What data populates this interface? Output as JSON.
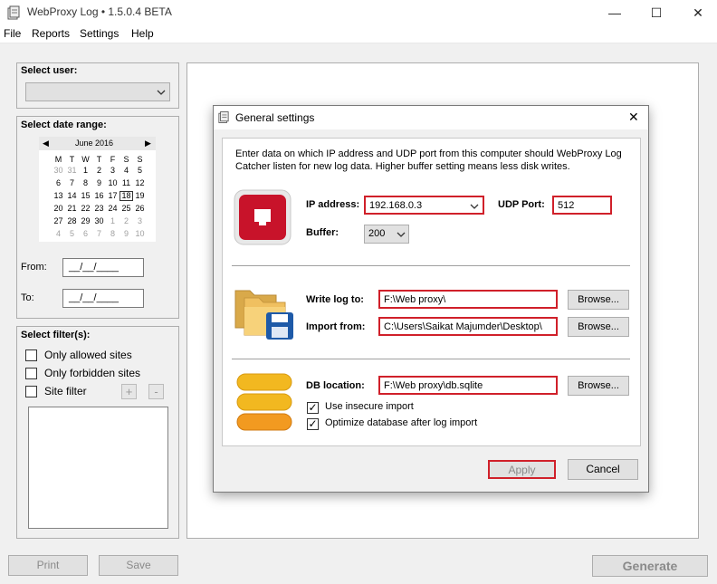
{
  "window": {
    "title": "WebProxy Log • 1.5.0.4 BETA",
    "minimize": "—",
    "maximize": "☐",
    "close": "✕"
  },
  "menu": [
    "File",
    "Reports",
    "Settings",
    "Help"
  ],
  "left": {
    "select_user_label": "Select user:",
    "select_date_label": "Select date range:",
    "calendar": {
      "month": "June 2016",
      "days": [
        "M",
        "T",
        "W",
        "T",
        "F",
        "S",
        "S"
      ],
      "weeks": [
        [
          "30",
          "31",
          "1",
          "2",
          "3",
          "4",
          "5"
        ],
        [
          "6",
          "7",
          "8",
          "9",
          "10",
          "11",
          "12"
        ],
        [
          "13",
          "14",
          "15",
          "16",
          "17",
          "18",
          "19"
        ],
        [
          "20",
          "21",
          "22",
          "23",
          "24",
          "25",
          "26"
        ],
        [
          "27",
          "28",
          "29",
          "30",
          "1",
          "2",
          "3"
        ],
        [
          "4",
          "5",
          "6",
          "7",
          "8",
          "9",
          "10"
        ]
      ]
    },
    "from_label": "From:",
    "from_value": "__/__/____",
    "to_label": "To:",
    "to_value": "__/__/____",
    "filters_label": "Select filter(s):",
    "filter_allowed": "Only allowed sites",
    "filter_forbidden": "Only forbidden sites",
    "filter_site": "Site filter",
    "plus": "+",
    "minus": "-"
  },
  "bottom": {
    "print": "Print",
    "save": "Save",
    "generate": "Generate"
  },
  "dialog": {
    "title": "General settings",
    "close": "✕",
    "description": "Enter data on which IP address and UDP port from this computer should WebProxy Log Catcher listen for new log data. Higher buffer setting means less disk writes.",
    "ip_label": "IP address:",
    "ip_value": "192.168.0.3",
    "udp_label": "UDP Port:",
    "udp_value": "512",
    "buffer_label": "Buffer:",
    "buffer_value": "200",
    "write_log_label": "Write log to:",
    "write_log_value": "F:\\Web proxy\\",
    "import_label": "Import from:",
    "import_value": "C:\\Users\\Saikat Majumder\\Desktop\\",
    "browse": "Browse...",
    "db_label": "DB location:",
    "db_value": "F:\\Web proxy\\db.sqlite",
    "insecure_label": "Use insecure import",
    "optimize_label": "Optimize database after log import",
    "apply": "Apply",
    "cancel": "Cancel"
  }
}
